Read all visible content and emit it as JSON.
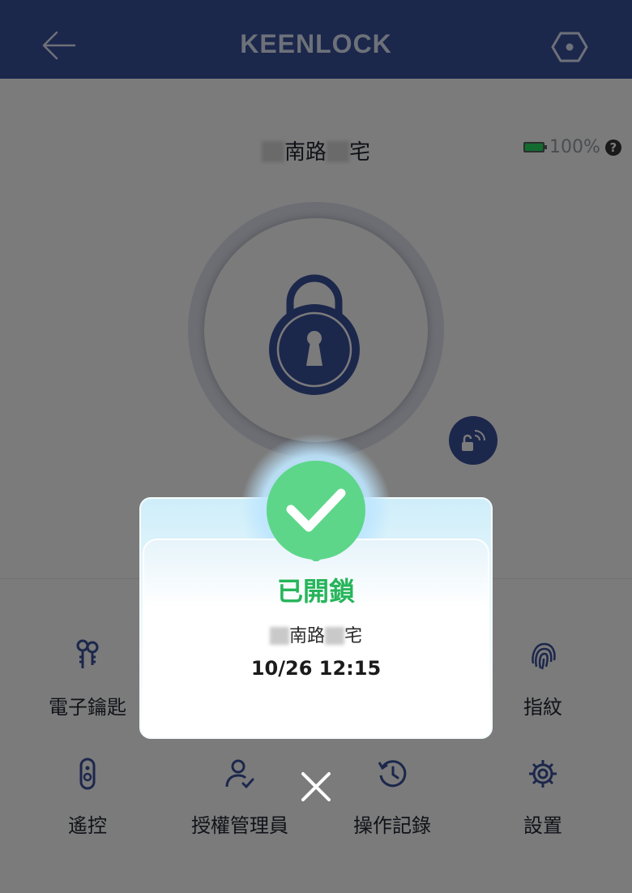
{
  "header": {
    "title": "KEENLOCK",
    "back_icon": "arrow-left-icon",
    "settings_icon": "hexagon-settings-icon"
  },
  "lock": {
    "name_middle": "南路",
    "name_end": "宅",
    "battery_text": "100%",
    "help_text": "?",
    "colors": {
      "accent": "#1c274c",
      "battery": "#146b2f"
    }
  },
  "functions": {
    "row1": [
      {
        "label": "電子鑰匙",
        "icon": "keys-icon"
      },
      {
        "label": "指紋",
        "icon": "fingerprint-icon"
      }
    ],
    "row2": [
      {
        "label": "遙控",
        "icon": "remote-control-icon"
      },
      {
        "label": "授權管理員",
        "icon": "user-check-icon"
      },
      {
        "label": "操作記錄",
        "icon": "history-icon"
      },
      {
        "label": "設置",
        "icon": "gear-icon"
      }
    ]
  },
  "modal": {
    "title": "已開鎖",
    "name_middle": "南路",
    "name_end": "宅",
    "time": "10/26 12:15",
    "success_color": "#26b55a"
  }
}
